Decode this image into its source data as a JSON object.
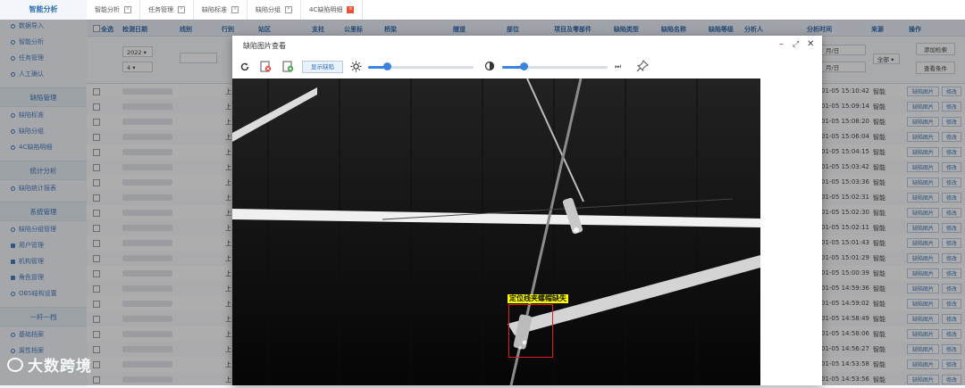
{
  "sidebar": {
    "top_label": "智能分析",
    "sections": [
      {
        "title": null,
        "items": [
          {
            "label": "数据导入",
            "icon": "circle-icon"
          },
          {
            "label": "智能分析",
            "icon": "circle-icon"
          },
          {
            "label": "任务管理",
            "icon": "circle-icon"
          },
          {
            "label": "人工确认",
            "icon": "circle-icon"
          }
        ]
      },
      {
        "title": "缺陷管理",
        "items": [
          {
            "label": "缺陷标准",
            "icon": "circle-icon"
          },
          {
            "label": "缺陷分组",
            "icon": "circle-icon"
          },
          {
            "label": "4C缺陷明细",
            "icon": "circle-icon"
          }
        ]
      },
      {
        "title": "统计分析",
        "items": [
          {
            "label": "缺陷统计报表",
            "icon": "circle-icon"
          }
        ]
      },
      {
        "title": "系统管理",
        "items": [
          {
            "label": "缺陷分组管理",
            "icon": "circle-icon"
          },
          {
            "label": "用户管理",
            "icon": "user-icon"
          },
          {
            "label": "机构管理",
            "icon": "org-icon"
          },
          {
            "label": "角色管理",
            "icon": "role-icon"
          },
          {
            "label": "OBS结构设置",
            "icon": "circle-icon"
          }
        ]
      },
      {
        "title": "一杆一档",
        "items": [
          {
            "label": "基础档案",
            "icon": "circle-icon"
          },
          {
            "label": "属性档案",
            "icon": "circle-icon"
          }
        ]
      }
    ],
    "watermark": "大数跨境"
  },
  "tabs": [
    {
      "label": "智能分析",
      "active": false
    },
    {
      "label": "任务管理",
      "active": false
    },
    {
      "label": "缺陷标准",
      "active": false
    },
    {
      "label": "缺陷分组",
      "active": false
    },
    {
      "label": "4C缺陷明细",
      "active": true
    }
  ],
  "grid": {
    "headers": [
      "全选",
      "检测日期",
      "线别",
      "行别",
      "站区",
      "支柱",
      "公里标",
      "桥梁",
      "隧道",
      "部位",
      "项目及零部件",
      "缺陷类型",
      "缺陷名称",
      "缺陷等级",
      "分析人",
      "分析时间",
      "来源",
      "操作"
    ],
    "filter": {
      "year": "2022",
      "month": "4",
      "date_start": "月/日",
      "date_end": "月/日",
      "source": "全部",
      "add_button": "添加检索",
      "reset_button": "查看条件"
    },
    "rows": [
      {
        "row": "上",
        "time": "01-05 15:10:42",
        "source": "智能"
      },
      {
        "row": "上",
        "time": "01-05 15:09:14",
        "source": "智能"
      },
      {
        "row": "上",
        "time": "01-05 15:08:20",
        "source": "智能"
      },
      {
        "row": "上",
        "time": "01-05 15:06:04",
        "source": "智能"
      },
      {
        "row": "上",
        "time": "01-05 15:04:15",
        "source": "智能"
      },
      {
        "row": "上",
        "time": "01-05 15:03:42",
        "source": "智能"
      },
      {
        "row": "上",
        "time": "01-05 15:03:36",
        "source": "智能"
      },
      {
        "row": "上",
        "time": "01-05 15:02:31",
        "source": "智能"
      },
      {
        "row": "上",
        "time": "01-05 15:02:30",
        "source": "智能"
      },
      {
        "row": "上",
        "time": "01-05 15:02:11",
        "source": "智能"
      },
      {
        "row": "上",
        "time": "01-05 15:01:43",
        "source": "智能"
      },
      {
        "row": "上",
        "time": "01-05 15:01:29",
        "source": "智能"
      },
      {
        "row": "上",
        "time": "01-05 15:00:39",
        "source": "智能"
      },
      {
        "row": "上",
        "time": "01-05 14:59:36",
        "source": "智能"
      },
      {
        "row": "上",
        "time": "01-05 14:59:02",
        "source": "智能"
      },
      {
        "row": "上",
        "time": "01-05 14:58:49",
        "source": "智能"
      },
      {
        "row": "上",
        "time": "01-05 14:58:06",
        "source": "智能"
      },
      {
        "row": "上",
        "time": "01-05 14:56:27",
        "source": "智能"
      },
      {
        "row": "上",
        "time": "01-05 14:53:58",
        "source": "智能"
      },
      {
        "row": "上",
        "time": "01-05 14:53:56",
        "source": "智能"
      }
    ],
    "row_btn_view": "缺陷图片",
    "row_btn_edit": "修改"
  },
  "dialog": {
    "title": "缺陷图片查看",
    "show_defect_label": "显示缺陷",
    "brightness": 0.18,
    "contrast": 0.2,
    "defect_annotation": "定位线夹螺帽缺失"
  },
  "colors": {
    "accent": "#2b6cb6",
    "defect_label_bg": "#ffff00",
    "defect_box": "#e02020"
  }
}
